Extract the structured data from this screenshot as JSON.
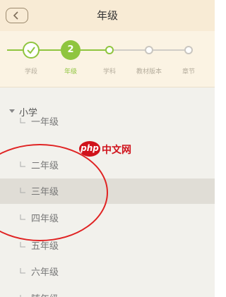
{
  "header": {
    "title": "年级"
  },
  "steps": [
    {
      "label": "学段",
      "state": "done"
    },
    {
      "label": "年级",
      "state": "current",
      "number": "2"
    },
    {
      "label": "学科",
      "state": "next"
    },
    {
      "label": "教材版本",
      "state": "pending"
    },
    {
      "label": "章节",
      "state": "pending"
    }
  ],
  "section": {
    "title": "小学"
  },
  "grades": [
    {
      "label": "一年级",
      "selected": false
    },
    {
      "label": "二年级",
      "selected": false
    },
    {
      "label": "三年级",
      "selected": true
    },
    {
      "label": "四年级",
      "selected": false
    },
    {
      "label": "五年级",
      "selected": false
    },
    {
      "label": "六年级",
      "selected": false
    },
    {
      "label": "随年级",
      "selected": false
    }
  ],
  "watermark": {
    "logo": "php",
    "text": "中文网"
  },
  "colors": {
    "accent": "#8fc53f",
    "header_bg": "#f8ebd5",
    "annotation": "#e02323"
  },
  "icons": {
    "back": "chevron-left-icon",
    "done": "checkmark-icon",
    "section": "caret-down-icon",
    "row": "corner-icon"
  }
}
